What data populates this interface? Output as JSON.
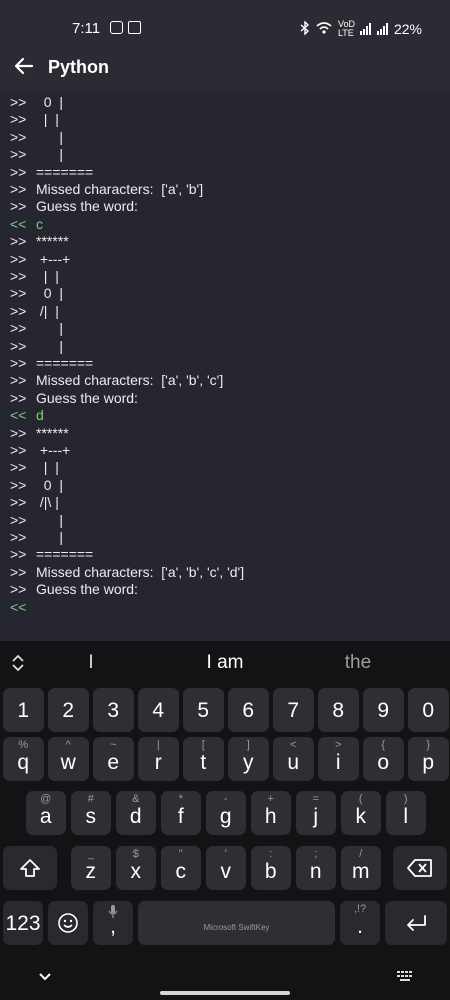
{
  "status": {
    "time": "7:11",
    "network_label": "VoD LTE",
    "battery": "22%"
  },
  "app": {
    "title": "Python"
  },
  "console": {
    "out_prefix": ">>",
    "in_prefix": "<<",
    "lines": [
      {
        "dir": "out",
        "text": "  0  |"
      },
      {
        "dir": "out",
        "text": "  |  |"
      },
      {
        "dir": "out",
        "text": "      |"
      },
      {
        "dir": "out",
        "text": "      |"
      },
      {
        "dir": "out",
        "text": "======="
      },
      {
        "dir": "out",
        "text": "Missed characters:  ['a', 'b']"
      },
      {
        "dir": "out",
        "text": "Guess the word:"
      },
      {
        "dir": "in",
        "text": "c"
      },
      {
        "dir": "out",
        "text": "******"
      },
      {
        "dir": "out",
        "text": " +---+"
      },
      {
        "dir": "out",
        "text": "  |  |"
      },
      {
        "dir": "out",
        "text": "  0  |"
      },
      {
        "dir": "out",
        "text": " /|  |"
      },
      {
        "dir": "out",
        "text": "      |"
      },
      {
        "dir": "out",
        "text": "      |"
      },
      {
        "dir": "out",
        "text": "======="
      },
      {
        "dir": "out",
        "text": "Missed characters:  ['a', 'b', 'c']"
      },
      {
        "dir": "out",
        "text": "Guess the word:"
      },
      {
        "dir": "in",
        "text": "d"
      },
      {
        "dir": "out",
        "text": "******"
      },
      {
        "dir": "out",
        "text": " +---+"
      },
      {
        "dir": "out",
        "text": "  |  |"
      },
      {
        "dir": "out",
        "text": "  0  |"
      },
      {
        "dir": "out",
        "text": " /|\\ |"
      },
      {
        "dir": "out",
        "text": "      |"
      },
      {
        "dir": "out",
        "text": "      |"
      },
      {
        "dir": "out",
        "text": "======="
      },
      {
        "dir": "out",
        "text": "Missed characters:  ['a', 'b', 'c', 'd']"
      },
      {
        "dir": "out",
        "text": "Guess the word:"
      },
      {
        "dir": "in",
        "text": ""
      }
    ]
  },
  "keyboard": {
    "suggestions": [
      "I",
      "I am",
      "the"
    ],
    "number_row": [
      "1",
      "2",
      "3",
      "4",
      "5",
      "6",
      "7",
      "8",
      "9",
      "0"
    ],
    "row1": [
      {
        "k": "q",
        "a": "%"
      },
      {
        "k": "w",
        "a": "^"
      },
      {
        "k": "e",
        "a": "~"
      },
      {
        "k": "r",
        "a": "|"
      },
      {
        "k": "t",
        "a": "["
      },
      {
        "k": "y",
        "a": "]"
      },
      {
        "k": "u",
        "a": "<"
      },
      {
        "k": "i",
        "a": ">"
      },
      {
        "k": "o",
        "a": "{"
      },
      {
        "k": "p",
        "a": "}"
      }
    ],
    "row2": [
      {
        "k": "a",
        "a": "@"
      },
      {
        "k": "s",
        "a": "#"
      },
      {
        "k": "d",
        "a": "&"
      },
      {
        "k": "f",
        "a": "*"
      },
      {
        "k": "g",
        "a": "-"
      },
      {
        "k": "h",
        "a": "+"
      },
      {
        "k": "j",
        "a": "="
      },
      {
        "k": "k",
        "a": "("
      },
      {
        "k": "l",
        "a": ")"
      }
    ],
    "row3": [
      {
        "k": "z",
        "a": "_"
      },
      {
        "k": "x",
        "a": "$"
      },
      {
        "k": "c",
        "a": "\""
      },
      {
        "k": "v",
        "a": "'"
      },
      {
        "k": "b",
        "a": ":"
      },
      {
        "k": "n",
        "a": ";"
      },
      {
        "k": "m",
        "a": "/"
      }
    ],
    "symbols_label": "123",
    "comma": ",",
    "period": ".",
    "period_alt": ",!?",
    "space_label": "Microsoft SwiftKey"
  }
}
